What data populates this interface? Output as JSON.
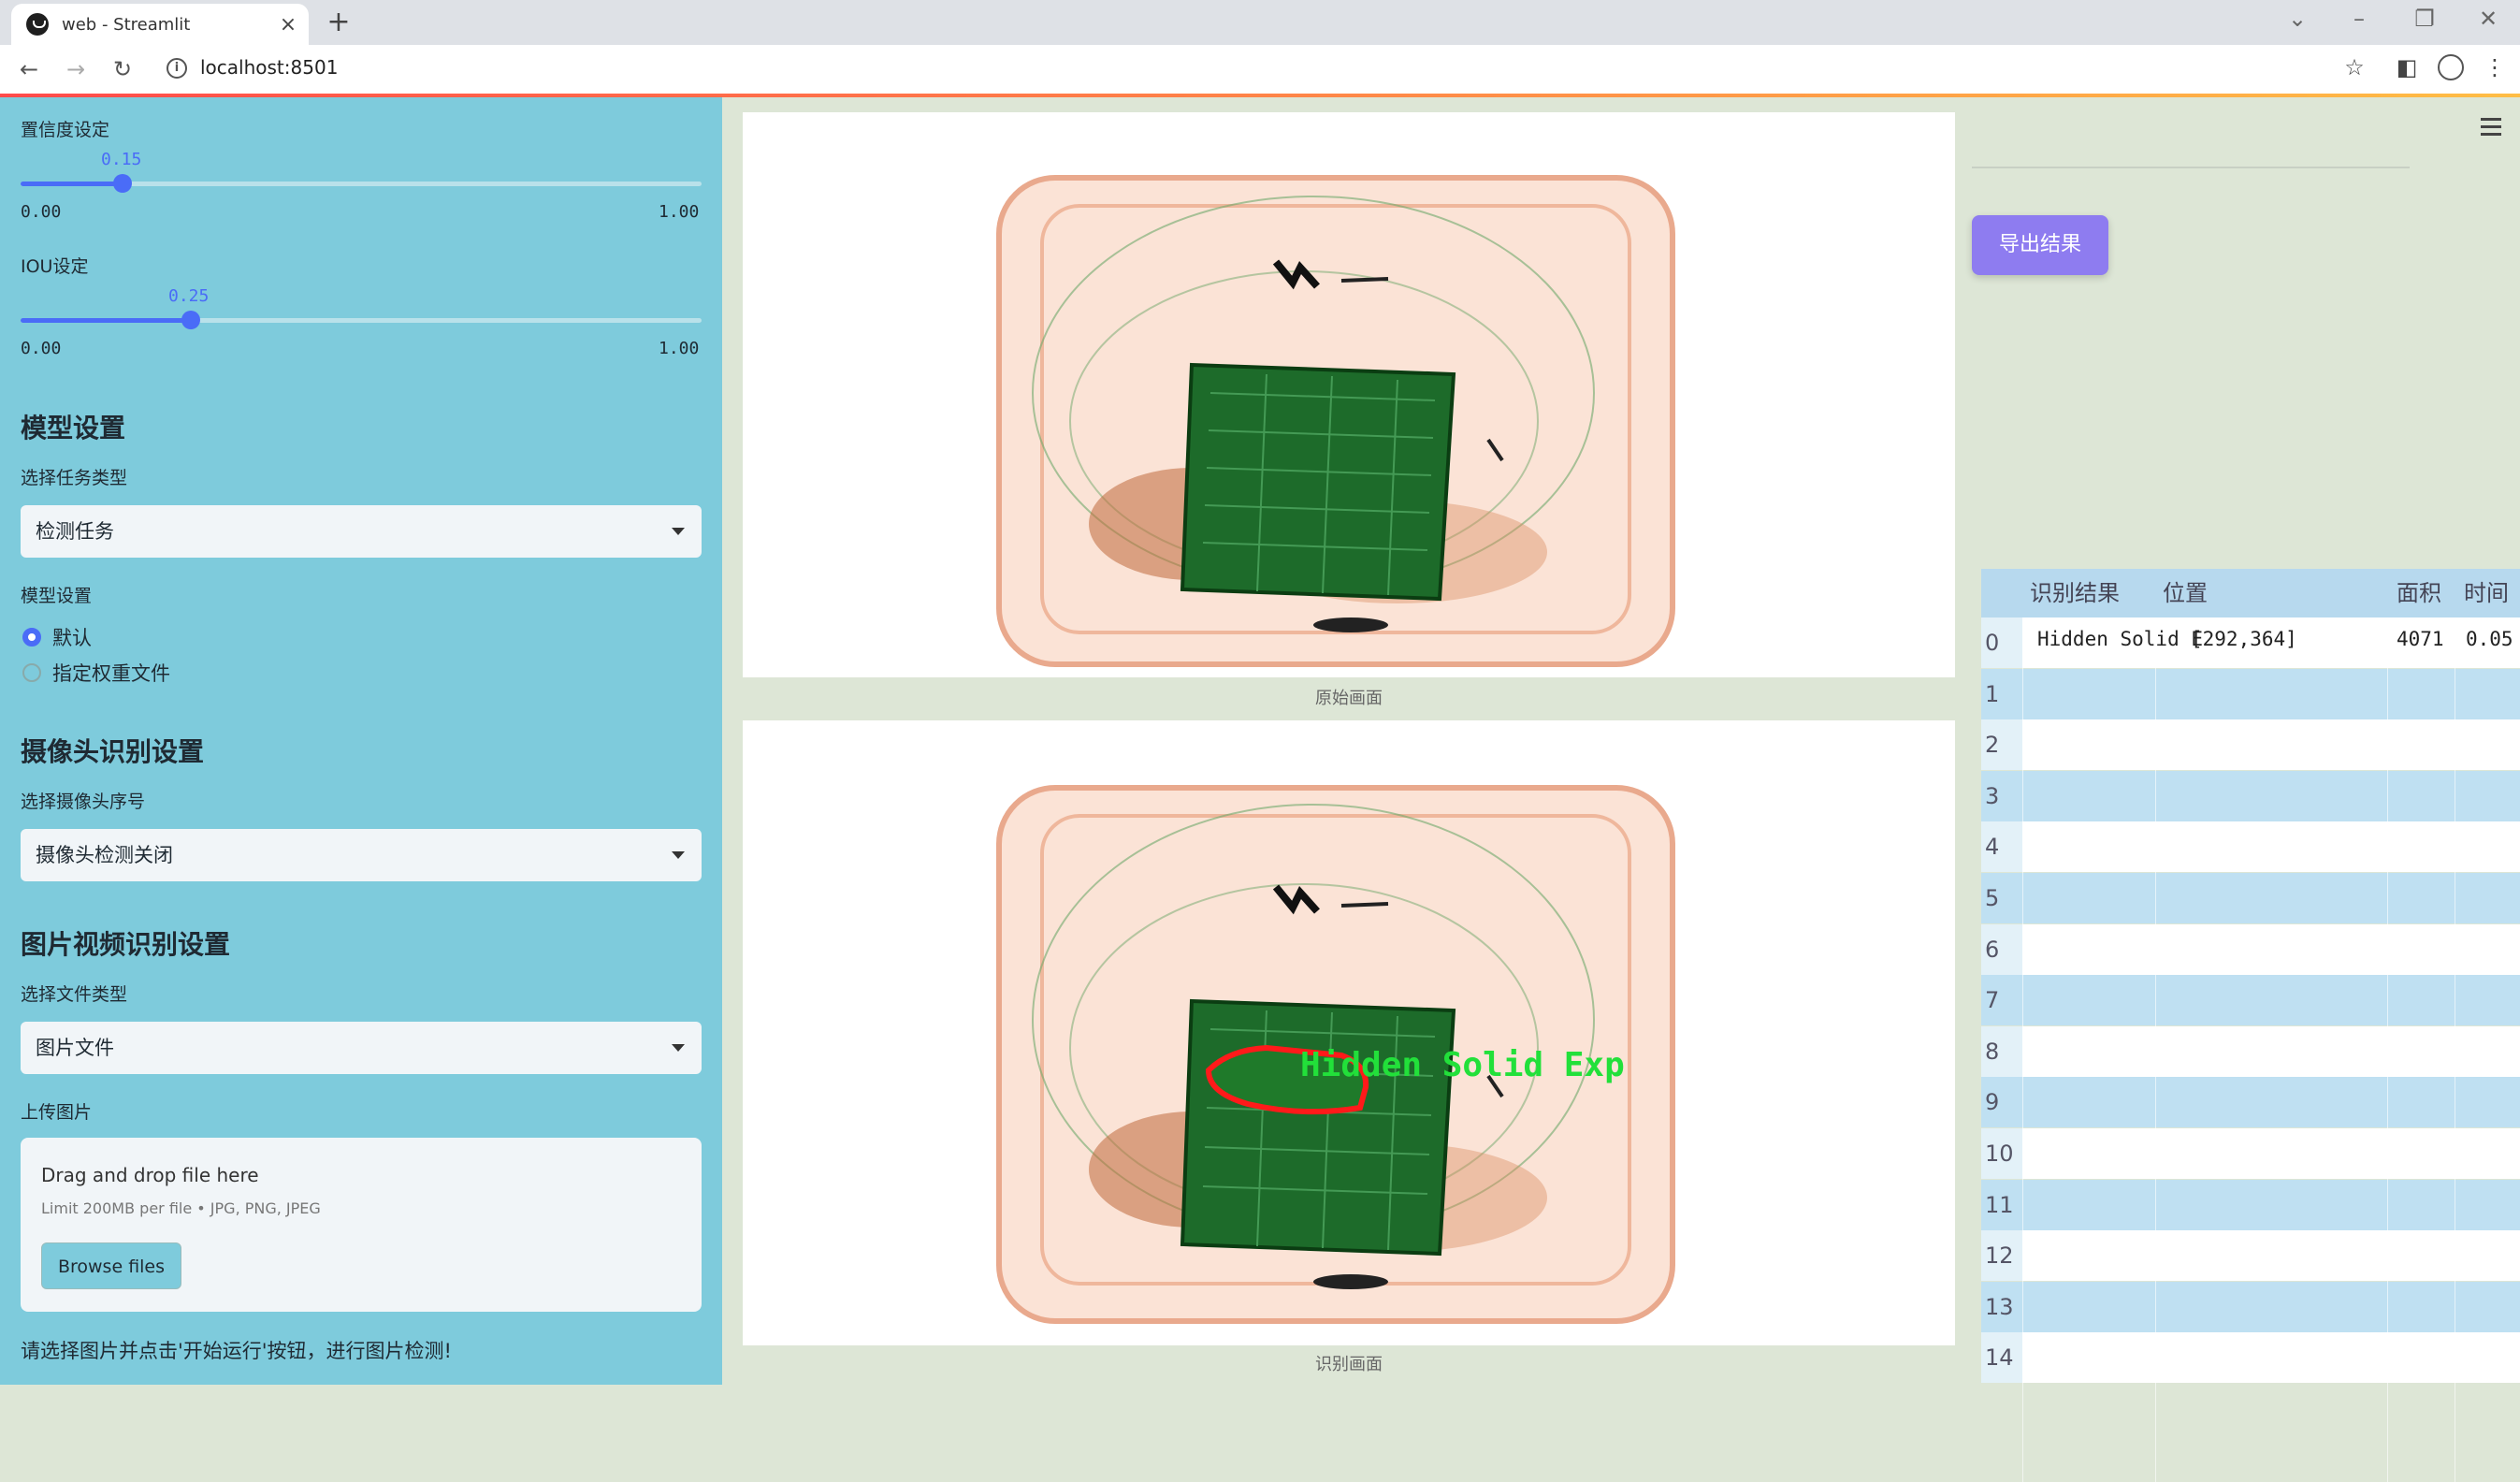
{
  "browser": {
    "tab_title": "web - Streamlit",
    "url": "localhost:8501"
  },
  "sidebar": {
    "confidence": {
      "label": "置信度设定",
      "value": "0.15",
      "min": "0.00",
      "max": "1.00",
      "fraction": 0.15
    },
    "iou": {
      "label": "IOU设定",
      "value": "0.25",
      "min": "0.00",
      "max": "1.00",
      "fraction": 0.25
    },
    "model_heading": "模型设置",
    "task_label": "选择任务类型",
    "task_value": "检测任务",
    "model_label": "模型设置",
    "radio_default": "默认",
    "radio_custom": "指定权重文件",
    "camera_heading": "摄像头识别设置",
    "camera_label": "选择摄像头序号",
    "camera_value": "摄像头检测关闭",
    "media_heading": "图片视频识别设置",
    "filetype_label": "选择文件类型",
    "filetype_value": "图片文件",
    "upload_label": "上传图片",
    "upload_title": "Drag and drop file here",
    "upload_limit": "Limit 200MB per file • JPG, PNG, JPEG",
    "browse_label": "Browse files",
    "footer_hint": "请选择图片并点击'开始运行'按钮，进行图片检测!"
  },
  "main": {
    "caption_original": "原始画面",
    "caption_result": "识别画面",
    "detection_label": "Hidden Solid Exp"
  },
  "right": {
    "export_label": "导出结果",
    "table": {
      "headers": [
        "识别结果",
        "位置",
        "面积",
        "时间"
      ],
      "indices": [
        "0",
        "1",
        "2",
        "3",
        "4",
        "5",
        "6",
        "7",
        "8",
        "9",
        "10",
        "11",
        "12",
        "13",
        "14"
      ],
      "row0": {
        "result": "Hidden Solid E",
        "position": "[292,364]",
        "area": "4071",
        "time": "0.05"
      }
    }
  },
  "colors": {
    "sidebar_bg": "#7ecbdc",
    "accent": "#4a6cf7",
    "export_button": "#8e7cf0",
    "detection_box": "#ff1a1a",
    "detection_text": "#22e03a"
  }
}
